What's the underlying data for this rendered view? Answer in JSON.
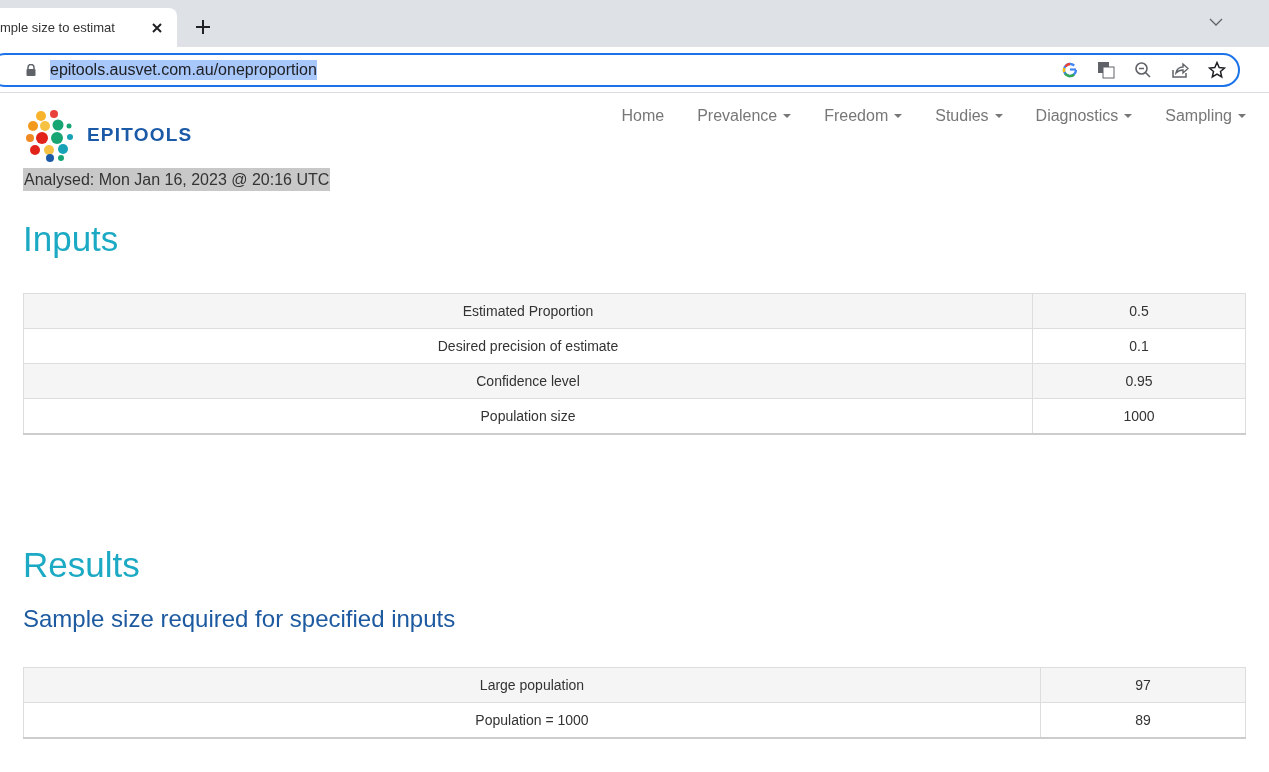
{
  "browser": {
    "tab": {
      "title": "mple size to estimat"
    },
    "address": "epitools.ausvet.com.au/oneproportion"
  },
  "site": {
    "logo_text": "EPITOOLS",
    "nav": [
      {
        "label": "Home",
        "dropdown": false
      },
      {
        "label": "Prevalence",
        "dropdown": true
      },
      {
        "label": "Freedom",
        "dropdown": true
      },
      {
        "label": "Studies",
        "dropdown": true
      },
      {
        "label": "Diagnostics",
        "dropdown": true
      },
      {
        "label": "Sampling",
        "dropdown": true
      }
    ]
  },
  "analysed": "Analysed: Mon Jan 16, 2023 @ 20:16 UTC",
  "inputs": {
    "heading": "Inputs",
    "rows": [
      {
        "label": "Estimated Proportion",
        "value": "0.5"
      },
      {
        "label": "Desired precision of estimate",
        "value": "0.1"
      },
      {
        "label": "Confidence level",
        "value": "0.95"
      },
      {
        "label": "Population size",
        "value": "1000"
      }
    ]
  },
  "results": {
    "heading": "Results",
    "subheading": "Sample size required for specified inputs",
    "rows": [
      {
        "label": "Large population",
        "value": "97"
      },
      {
        "label": "Population = 1000",
        "value": "89"
      }
    ]
  }
}
